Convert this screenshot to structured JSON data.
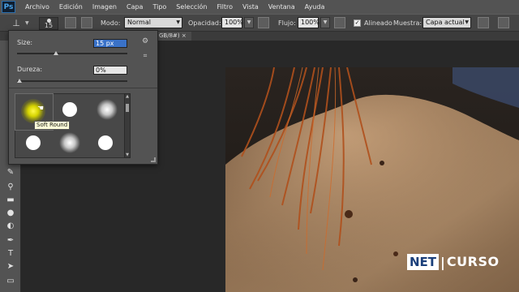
{
  "menubar": {
    "logo": "Ps",
    "items": [
      "Archivo",
      "Edición",
      "Imagen",
      "Capa",
      "Tipo",
      "Selección",
      "Filtro",
      "Vista",
      "Ventana",
      "Ayuda"
    ]
  },
  "options": {
    "brush_size": "15",
    "modo_label": "Modo:",
    "modo_value": "Normal",
    "opacidad_label": "Opacidad:",
    "opacidad_value": "100%",
    "flujo_label": "Flujo:",
    "flujo_value": "100%",
    "alineado_label": "Alineado",
    "muestra_label": "Muestra:",
    "muestra_value": "Capa actual"
  },
  "document_tab": {
    "label": "GB/8#) ×"
  },
  "brush_picker": {
    "size_label": "Size:",
    "size_value": "15 px",
    "size_level": 0.35,
    "dureza_label": "Dureza:",
    "dureza_value": "0%",
    "dureza_level": 0.0,
    "selected_tooltip": "Soft Round",
    "presets": [
      "soft-selected",
      "hard",
      "soft",
      "hard",
      "soft",
      "hard"
    ]
  },
  "watermark": {
    "box": "NET",
    "text": "CURSO"
  },
  "icons": {
    "selected_brush_color": "#fff94a"
  }
}
